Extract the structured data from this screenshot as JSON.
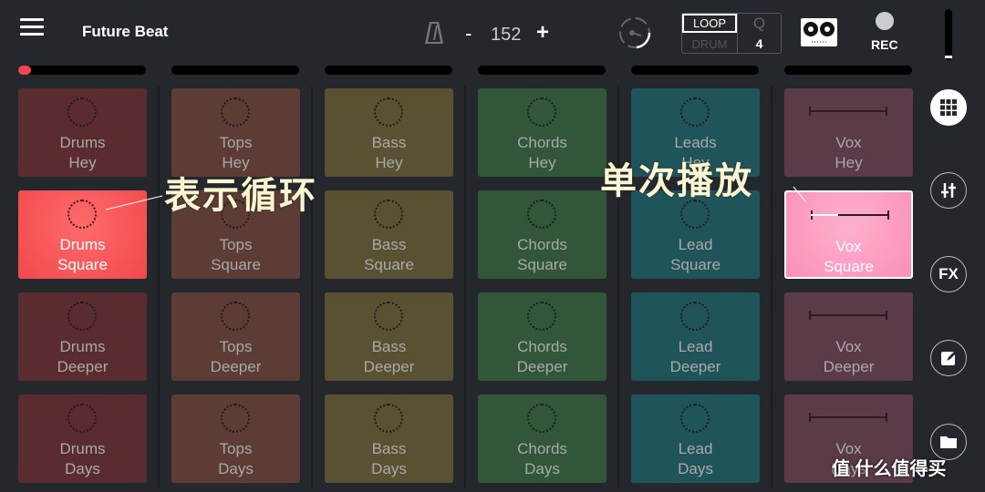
{
  "header": {
    "title": "Future Beat",
    "bpm": "152",
    "minus": "-",
    "plus": "+",
    "loop": "LOOP",
    "drum": "DRUM",
    "q_label": "Q",
    "q_value": "4",
    "rec": "REC"
  },
  "tracks": [
    {
      "name": "Drums",
      "color": "#5a2b2f",
      "progress": 0.1
    },
    {
      "name": "Tops",
      "color": "#5c3c34",
      "progress": 0
    },
    {
      "name": "Bass",
      "color": "#595131",
      "progress": 0
    },
    {
      "name": "Chords",
      "color": "#31563a",
      "progress": 0
    },
    {
      "name": "Leads",
      "color": "#20545b",
      "progress": 0
    },
    {
      "name": "Vox",
      "color": "#5b3b49",
      "progress": 0
    }
  ],
  "pads": [
    [
      [
        "Drums",
        "Hey",
        "loop"
      ],
      [
        "Drums",
        "Square",
        "loop",
        "active",
        "#f0494d"
      ],
      [
        "Drums",
        "Deeper",
        "loop"
      ],
      [
        "Drums",
        "Days",
        "loop"
      ]
    ],
    [
      [
        "Tops",
        "Hey",
        "loop"
      ],
      [
        "Tops",
        "Square",
        "loop"
      ],
      [
        "Tops",
        "Deeper",
        "loop"
      ],
      [
        "Tops",
        "Days",
        "loop"
      ]
    ],
    [
      [
        "Bass",
        "Hey",
        "loop"
      ],
      [
        "Bass",
        "Square",
        "loop"
      ],
      [
        "Bass",
        "Deeper",
        "loop"
      ],
      [
        "Bass",
        "Days",
        "loop"
      ]
    ],
    [
      [
        "Chords",
        "Hey",
        "loop"
      ],
      [
        "Chords",
        "Square",
        "loop"
      ],
      [
        "Chords",
        "Deeper",
        "loop"
      ],
      [
        "Chords",
        "Days",
        "loop"
      ]
    ],
    [
      [
        "Leads",
        "Hey",
        "loop"
      ],
      [
        "Lead",
        "Square",
        "loop"
      ],
      [
        "Lead",
        "Deeper",
        "loop"
      ],
      [
        "Lead",
        "Days",
        "loop"
      ]
    ],
    [
      [
        "Vox",
        "Hey",
        "oneshot"
      ],
      [
        "Vox",
        "Square",
        "oneshot",
        "active",
        "#fb8fb8"
      ],
      [
        "Vox",
        "Deeper",
        "oneshot"
      ],
      [
        "Vox",
        "Days",
        "oneshot"
      ]
    ]
  ],
  "active_oneshot_progress": 0.35,
  "sidebar": {
    "fx": "FX"
  },
  "annotations": {
    "loop": "表示循环",
    "oneshot": "单次播放"
  },
  "watermark": "值 什么值得买"
}
